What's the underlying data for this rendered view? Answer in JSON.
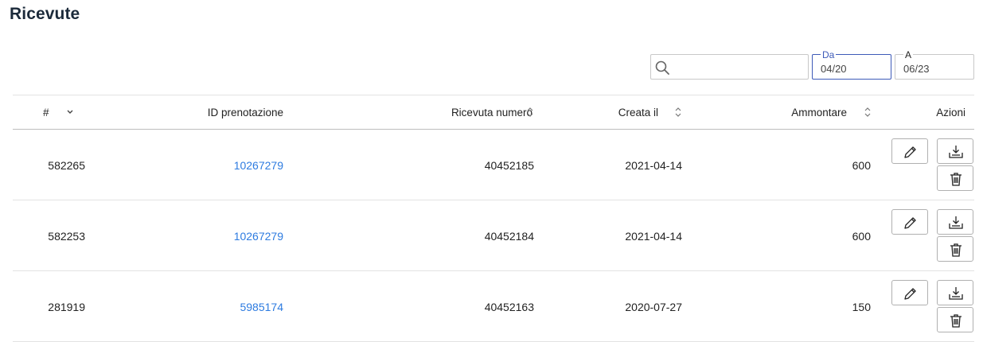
{
  "page": {
    "title": "Ricevute"
  },
  "filters": {
    "search": {
      "value": "",
      "placeholder": ""
    },
    "date_from": {
      "label": "Da",
      "value": "04/20"
    },
    "date_to": {
      "label": "A",
      "value": "06/23"
    }
  },
  "table": {
    "headers": {
      "number": "#",
      "booking_id": "ID prenotazione",
      "receipt_number": "Ricevuta numero",
      "created": "Creata il",
      "amount": "Ammontare",
      "actions": "Azioni"
    },
    "rows": [
      {
        "number": "582265",
        "booking_id": "10267279",
        "receipt_number": "40452185",
        "created": "2021-04-14",
        "amount": "600"
      },
      {
        "number": "582253",
        "booking_id": "10267279",
        "receipt_number": "40452184",
        "created": "2021-04-14",
        "amount": "600"
      },
      {
        "number": "281919",
        "booking_id": "5985174",
        "receipt_number": "40452163",
        "created": "2020-07-27",
        "amount": "150"
      }
    ],
    "row_actions": [
      "pencil-icon",
      "download-icon",
      "trash-icon"
    ]
  },
  "colors": {
    "link": "#2d7be0",
    "active_border": "#3d5ab8",
    "title": "#1b2a3a"
  }
}
